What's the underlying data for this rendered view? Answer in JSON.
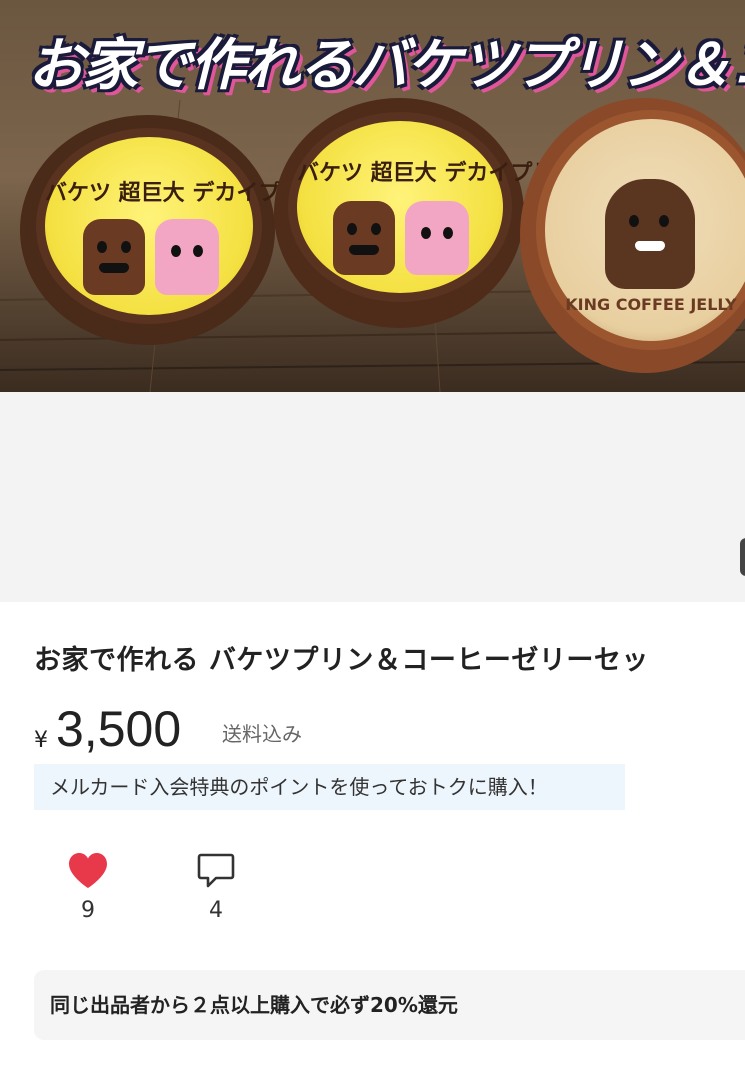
{
  "photo": {
    "overlay_title": "お家で作れるバケツプリン＆コーヒーゼリーセッ",
    "lid1_text": "バケツ 超巨大 デカイプリン",
    "lid2_text": "バケツ 超巨大 デカイプリン",
    "lid3_text": "KING COFFEE JELLY"
  },
  "product": {
    "title": "お家で作れる バケツプリン＆コーヒーゼリーセッ",
    "currency_symbol": "¥",
    "price": "3,500",
    "shipping": "送料込み",
    "promo": "メルカード入会特典のポイントを使っておトクに購入！"
  },
  "actions": {
    "like_count": "9",
    "comment_count": "4"
  },
  "bundle_offer": "同じ出品者から２点以上購入で必ず20%還元",
  "colors": {
    "heart": "#e8394a",
    "promo_bg": "#eef6fd",
    "photo_bg": "#f3f3f3"
  }
}
